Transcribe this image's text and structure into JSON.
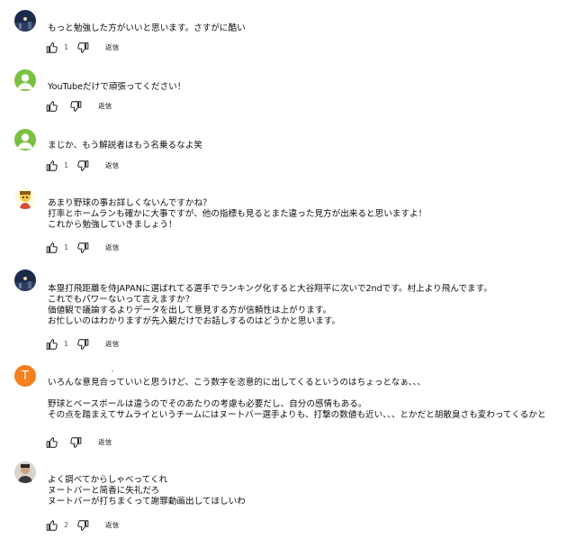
{
  "labels": {
    "reply": "返信"
  },
  "colors": {
    "text": "#0f0f0f",
    "meta": "#606060",
    "avatar_green": "#7ac142",
    "avatar_orange": "#f4801e"
  },
  "comments": [
    {
      "avatar": "night-photo-avatar",
      "lines": [
        "もっと勉強した方がいいと思います。さすがに酷い"
      ],
      "likes": "1"
    },
    {
      "avatar": "green-default-avatar",
      "lines": [
        "YouTubeだけで頑張ってください！"
      ],
      "likes": ""
    },
    {
      "avatar": "green-default-avatar",
      "lines": [
        "まじか、もう解説者はもう名乗るなよ笑"
      ],
      "likes": "1"
    },
    {
      "avatar": "character-avatar",
      "lines": [
        "あまり野球の事お詳しくないんですかね？",
        "打率とホームランも確かに大事ですが、他の指標も見るとまた違った見方が出来ると思いますよ！",
        "これから勉強していきましょう！"
      ],
      "likes": "1"
    },
    {
      "avatar": "night-photo-avatar",
      "lines": [
        "本塁打飛距離を侍JAPANに選ばれてる選手でランキング化すると大谷翔平に次いで2ndです。村上より飛んでます。",
        "これでもパワーないって言えますか？",
        "価値観で議論するよりデータを出して意見する方が信頼性は上がります。",
        "お忙しいのはわかりますが先入観だけでお話しするのはどうかと思います。"
      ],
      "likes": "1"
    },
    {
      "avatar": "letter-avatar",
      "letter": "T",
      "lines": [
        "いろんな意見合っていいと思うけど、こう数字を恣意的に出してくるというのはちょっとなぁ、、、",
        "",
        "野球とベースボールは違うのでそのあたりの考慮も必要だし、自分の感情もある。",
        "その点を踏まえてサムライというチームにはヌートバー選手よりも、打撃の数値も近い、、、とかだと胡散臭さも変わってくるかと"
      ],
      "likes": ""
    },
    {
      "avatar": "person-photo-avatar",
      "lines": [
        "よく調べてからしゃべってくれ",
        "ヌートバーと简香に失礼だろ",
        "ヌートバーが打ちまくって謝罪動画出してほしいわ"
      ],
      "likes": "2"
    }
  ]
}
